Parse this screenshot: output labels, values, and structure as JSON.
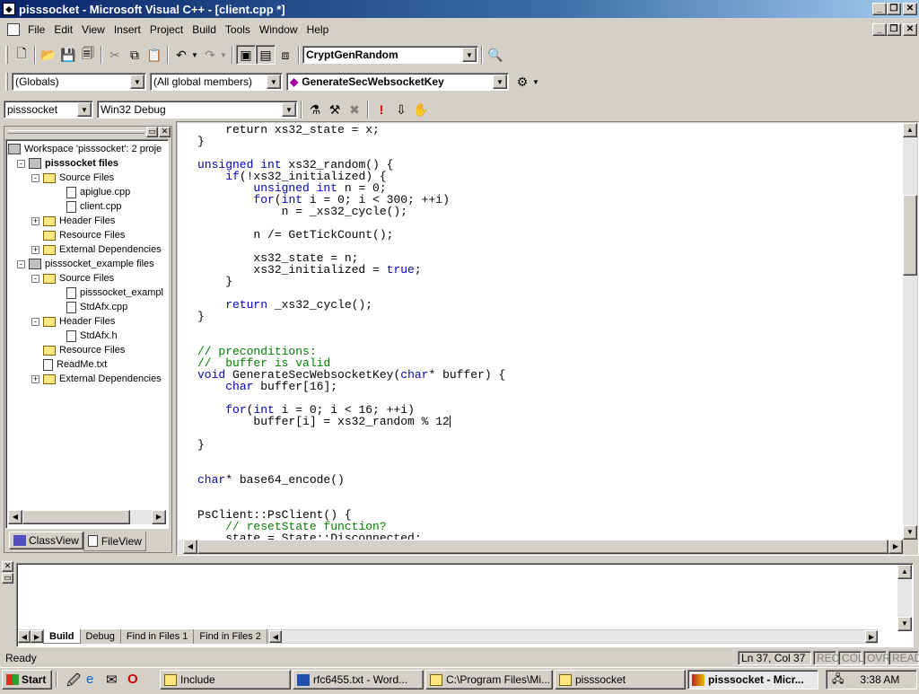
{
  "window": {
    "title": "pisssocket - Microsoft Visual C++ - [client.cpp *]"
  },
  "menu": [
    "File",
    "Edit",
    "View",
    "Insert",
    "Project",
    "Build",
    "Tools",
    "Window",
    "Help"
  ],
  "toolbar": {
    "find_combo": "CryptGenRandom"
  },
  "wizardbar": {
    "scope": "(Globals)",
    "members": "(All global members)",
    "function": "GenerateSecWebsocketKey"
  },
  "buildbar": {
    "project": "pisssocket",
    "config": "Win32 Debug"
  },
  "workspace": {
    "root": "Workspace 'pisssocket': 2 proje",
    "items": [
      {
        "label": "pisssocket files",
        "type": "proj",
        "expander": "-"
      },
      {
        "label": "Source Files",
        "type": "folder",
        "expander": "-"
      },
      {
        "label": "apiglue.cpp",
        "type": "file",
        "expander": ""
      },
      {
        "label": "client.cpp",
        "type": "file",
        "expander": ""
      },
      {
        "label": "Header Files",
        "type": "folder",
        "expander": "+"
      },
      {
        "label": "Resource Files",
        "type": "folder",
        "expander": ""
      },
      {
        "label": "External Dependencies",
        "type": "folder",
        "expander": "+"
      },
      {
        "label": "pisssocket_example files",
        "type": "proj",
        "expander": "-"
      },
      {
        "label": "Source Files",
        "type": "folder",
        "expander": "-"
      },
      {
        "label": "pisssocket_exampl",
        "type": "file",
        "expander": ""
      },
      {
        "label": "StdAfx.cpp",
        "type": "file",
        "expander": ""
      },
      {
        "label": "Header Files",
        "type": "folder",
        "expander": "-"
      },
      {
        "label": "StdAfx.h",
        "type": "file",
        "expander": ""
      },
      {
        "label": "Resource Files",
        "type": "folder",
        "expander": ""
      },
      {
        "label": "ReadMe.txt",
        "type": "file",
        "expander": ""
      },
      {
        "label": "External Dependencies",
        "type": "folder",
        "expander": "+"
      }
    ],
    "tabs": [
      "ClassView",
      "FileView"
    ]
  },
  "editor": {
    "lines": [
      [
        [
          "",
          "    return xs32_state = x;"
        ]
      ],
      [
        [
          "",
          "}"
        ]
      ],
      [
        [
          "",
          ""
        ]
      ],
      [
        [
          "kw",
          "unsigned int"
        ],
        [
          "",
          " xs32_random() {"
        ]
      ],
      [
        [
          "",
          "    "
        ],
        [
          "kw",
          "if"
        ],
        [
          "",
          "(!xs32_initialized) {"
        ]
      ],
      [
        [
          "",
          "        "
        ],
        [
          "kw",
          "unsigned int"
        ],
        [
          "",
          " n = 0;"
        ]
      ],
      [
        [
          "",
          "        "
        ],
        [
          "kw",
          "for"
        ],
        [
          "",
          "("
        ],
        [
          "kw",
          "int"
        ],
        [
          "",
          " i = 0; i < 300; ++i)"
        ]
      ],
      [
        [
          "",
          "            n = _xs32_cycle();"
        ]
      ],
      [
        [
          "",
          ""
        ]
      ],
      [
        [
          "",
          "        n /= GetTickCount();"
        ]
      ],
      [
        [
          "",
          ""
        ]
      ],
      [
        [
          "",
          "        xs32_state = n;"
        ]
      ],
      [
        [
          "",
          "        xs32_initialized = "
        ],
        [
          "kw",
          "true"
        ],
        [
          "",
          ";"
        ]
      ],
      [
        [
          "",
          "    }"
        ]
      ],
      [
        [
          "",
          ""
        ]
      ],
      [
        [
          "",
          "    "
        ],
        [
          "kw",
          "return"
        ],
        [
          "",
          " _xs32_cycle();"
        ]
      ],
      [
        [
          "",
          "}"
        ]
      ],
      [
        [
          "",
          ""
        ]
      ],
      [
        [
          "",
          ""
        ]
      ],
      [
        [
          "cm",
          "// preconditions:"
        ]
      ],
      [
        [
          "cm",
          "//  buffer is valid"
        ]
      ],
      [
        [
          "kw",
          "void"
        ],
        [
          "",
          " GenerateSecWebsocketKey("
        ],
        [
          "kw",
          "char"
        ],
        [
          "",
          "* buffer) {"
        ]
      ],
      [
        [
          "",
          "    "
        ],
        [
          "kw",
          "char"
        ],
        [
          "",
          " buffer[16];"
        ]
      ],
      [
        [
          "",
          ""
        ]
      ],
      [
        [
          "",
          "    "
        ],
        [
          "kw",
          "for"
        ],
        [
          "",
          "("
        ],
        [
          "kw",
          "int"
        ],
        [
          "",
          " i = 0; i < 16; ++i)"
        ]
      ],
      [
        [
          "",
          "        buffer[i] = xs32_random % 12"
        ]
      ],
      [
        [
          "",
          ""
        ]
      ],
      [
        [
          "",
          "}"
        ]
      ],
      [
        [
          "",
          ""
        ]
      ],
      [
        [
          "",
          ""
        ]
      ],
      [
        [
          "kw",
          "char"
        ],
        [
          "",
          "* base64_encode()"
        ]
      ],
      [
        [
          "",
          ""
        ]
      ],
      [
        [
          "",
          ""
        ]
      ],
      [
        [
          "",
          "PsClient::PsClient() {"
        ]
      ],
      [
        [
          "",
          "    "
        ],
        [
          "cm",
          "// resetState function?"
        ]
      ],
      [
        [
          "",
          "    state = State::Disconnected;"
        ]
      ]
    ]
  },
  "output": {
    "tabs": [
      "Build",
      "Debug",
      "Find in Files 1",
      "Find in Files 2"
    ]
  },
  "status": {
    "ready": "Ready",
    "position": "Ln 37, Col 37",
    "rec": "REC",
    "col": "COL",
    "ovr": "OVR",
    "read": "READ"
  },
  "taskbar": {
    "start": "Start",
    "tasks": [
      "Include",
      "rfc6455.txt - Word...",
      "C:\\Program Files\\Mi...",
      "pisssocket",
      "pisssocket - Micr..."
    ],
    "clock": "3:38 AM"
  }
}
